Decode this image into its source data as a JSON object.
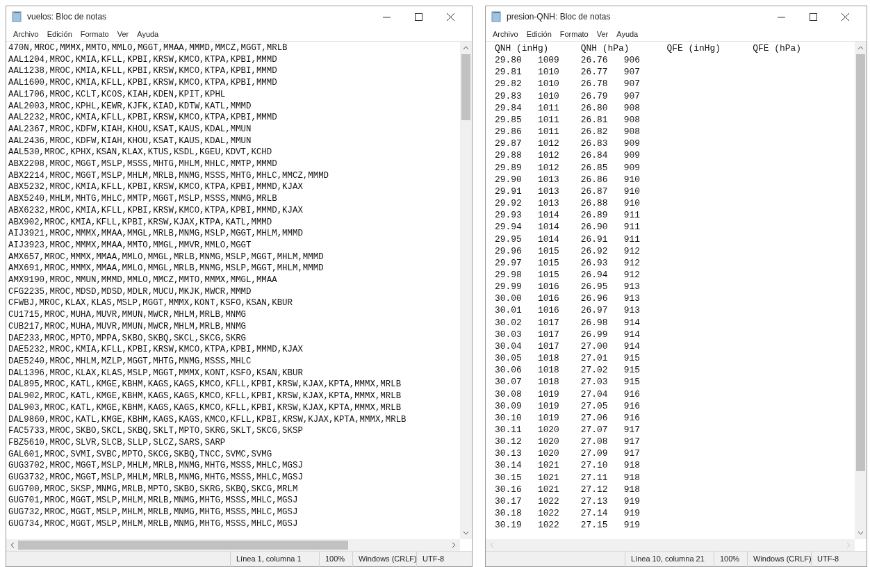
{
  "windows": [
    {
      "title": "vuelos: Bloc de notas",
      "menu": [
        "Archivo",
        "Edición",
        "Formato",
        "Ver",
        "Ayuda"
      ],
      "lines": [
        "470N,MROC,MMMX,MMTO,MMLO,MGGT,MMAA,MMMD,MMCZ,MGGT,MRLB",
        "AAL1204,MROC,KMIA,KFLL,KPBI,KRSW,KMCO,KTPA,KPBI,MMMD",
        "AAL1238,MROC,KMIA,KFLL,KPBI,KRSW,KMCO,KTPA,KPBI,MMMD",
        "AAL1600,MROC,KMIA,KFLL,KPBI,KRSW,KMCO,KTPA,KPBI,MMMD",
        "AAL1706,MROC,KCLT,KCOS,KIAH,KDEN,KPIT,KPHL",
        "AAL2003,MROC,KPHL,KEWR,KJFK,KIAD,KDTW,KATL,MMMD",
        "AAL2232,MROC,KMIA,KFLL,KPBI,KRSW,KMCO,KTPA,KPBI,MMMD",
        "AAL2367,MROC,KDFW,KIAH,KHOU,KSAT,KAUS,KDAL,MMUN",
        "AAL2436,MROC,KDFW,KIAH,KHOU,KSAT,KAUS,KDAL,MMUN",
        "AAL530,MROC,KPHX,KSAN,KLAX,KTUS,KSDL,KGEU,KDVT,KCHD",
        "ABX2208,MROC,MGGT,MSLP,MSSS,MHTG,MHLM,MHLC,MMTP,MMMD",
        "ABX2214,MROC,MGGT,MSLP,MHLM,MRLB,MNMG,MSSS,MHTG,MHLC,MMCZ,MMMD",
        "ABX5232,MROC,KMIA,KFLL,KPBI,KRSW,KMCO,KTPA,KPBI,MMMD,KJAX",
        "ABX5240,MHLM,MHTG,MHLC,MMTP,MGGT,MSLP,MSSS,MNMG,MRLB",
        "ABX6232,MROC,KMIA,KFLL,KPBI,KRSW,KMCO,KTPA,KPBI,MMMD,KJAX",
        "ABX902,MROC,KMIA,KFLL,KPBI,KRSW,KJAX,KTPA,KATL,MMMD",
        "AIJ3921,MROC,MMMX,MMAA,MMGL,MRLB,MNMG,MSLP,MGGT,MHLM,MMMD",
        "AIJ3923,MROC,MMMX,MMAA,MMTO,MMGL,MMVR,MMLO,MGGT",
        "AMX657,MROC,MMMX,MMAA,MMLO,MMGL,MRLB,MNMG,MSLP,MGGT,MHLM,MMMD",
        "AMX691,MROC,MMMX,MMAA,MMLO,MMGL,MRLB,MNMG,MSLP,MGGT,MHLM,MMMD",
        "AMX9190,MROC,MMUN,MMMD,MMLO,MMCZ,MMTO,MMMX,MMGL,MMAA",
        "CFG2235,MROC,MDSD,MDSD,MDLR,MUCU,MKJK,MWCR,MMMD",
        "CFWBJ,MROC,KLAX,KLAS,MSLP,MGGT,MMMX,KONT,KSFO,KSAN,KBUR",
        "CU1715,MROC,MUHA,MUVR,MMUN,MWCR,MHLM,MRLB,MNMG",
        "CUB217,MROC,MUHA,MUVR,MMUN,MWCR,MHLM,MRLB,MNMG",
        "DAE233,MROC,MPTO,MPPA,SKBO,SKBQ,SKCL,SKCG,SKRG",
        "DAE5232,MROC,KMIA,KFLL,KPBI,KRSW,KMCO,KTPA,KPBI,MMMD,KJAX",
        "DAE5240,MROC,MHLM,MZLP,MGGT,MHTG,MNMG,MSSS,MHLC",
        "DAL1396,MROC,KLAX,KLAS,MSLP,MGGT,MMMX,KONT,KSFO,KSAN,KBUR",
        "DAL895,MROC,KATL,KMGE,KBHM,KAGS,KAGS,KMCO,KFLL,KPBI,KRSW,KJAX,KPTA,MMMX,MRLB",
        "DAL902,MROC,KATL,KMGE,KBHM,KAGS,KAGS,KMCO,KFLL,KPBI,KRSW,KJAX,KPTA,MMMX,MRLB",
        "DAL903,MROC,KATL,KMGE,KBHM,KAGS,KAGS,KMCO,KFLL,KPBI,KRSW,KJAX,KPTA,MMMX,MRLB",
        "DAL9860,MROC,KATL,KMGE,KBHM,KAGS,KAGS,KMCO,KFLL,KPBI,KRSW,KJAX,KPTA,MMMX,MRLB",
        "FAC5733,MROC,SKBO,SKCL,SKBQ,SKLT,MPTO,SKRG,SKLT,SKCG,SKSP",
        "FBZ5610,MROC,SLVR,SLCB,SLLP,SLCZ,SARS,SARP",
        "GAL601,MROC,SVMI,SVBC,MPTO,SKCG,SKBQ,TNCC,SVMC,SVMG",
        "GUG3702,MROC,MGGT,MSLP,MHLM,MRLB,MNMG,MHTG,MSSS,MHLC,MGSJ",
        "GUG3732,MROC,MGGT,MSLP,MHLM,MRLB,MNMG,MHTG,MSSS,MHLC,MGSJ",
        "GUG700,MROC,SKSP,MNMG,MRLB,MPTO,SKBO,SKRG,SKBQ,SKCG,MRLM",
        "GUG701,MROC,MGGT,MSLP,MHLM,MRLB,MNMG,MHTG,MSSS,MHLC,MGSJ",
        "GUG732,MROC,MGGT,MSLP,MHLM,MRLB,MNMG,MHTG,MSSS,MHLC,MGSJ",
        "GUG734,MROC,MGGT,MSLP,MHLM,MRLB,MNMG,MHTG,MSSS,MHLC,MGSJ"
      ],
      "status": [
        "Línea 1, columna 1",
        "100%",
        "Windows (CRLF)",
        "UTF-8"
      ]
    },
    {
      "title": "presion-QNH: Bloc de notas",
      "menu": [
        "Archivo",
        "Edición",
        "Formato",
        "Ver",
        "Ayuda"
      ],
      "lines": [
        "QNH (inHg)\tQNH (hPa)\tQFE (inHg)\tQFE (hPa)",
        "29.80\t1009\t26.76\t906",
        "29.81\t1010\t26.77\t907",
        "29.82\t1010\t26.78\t907",
        "29.83\t1010\t26.79\t907",
        "29.84\t1011\t26.80\t908",
        "29.85\t1011\t26.81\t908",
        "29.86\t1011\t26.82\t908",
        "29.87\t1012\t26.83\t909",
        "29.88\t1012\t26.84\t909",
        "29.89\t1012\t26.85\t909",
        "29.90\t1013\t26.86\t910",
        "29.91\t1013\t26.87\t910",
        "29.92\t1013\t26.88\t910",
        "29.93\t1014\t26.89\t911",
        "29.94\t1014\t26.90\t911",
        "29.95\t1014\t26.91\t911",
        "29.96\t1015\t26.92\t912",
        "29.97\t1015\t26.93\t912",
        "29.98\t1015\t26.94\t912",
        "29.99\t1016\t26.95\t913",
        "30.00\t1016\t26.96\t913",
        "30.01\t1016\t26.97\t913",
        "30.02\t1017\t26.98\t914",
        "30.03\t1017\t26.99\t914",
        "30.04\t1017\t27.00\t914",
        "30.05\t1018\t27.01\t915",
        "30.06\t1018\t27.02\t915",
        "30.07\t1018\t27.03\t915",
        "30.08\t1019\t27.04\t916",
        "30.09\t1019\t27.05\t916",
        "30.10\t1019\t27.06\t916",
        "30.11\t1020\t27.07\t917",
        "30.12\t1020\t27.08\t917",
        "30.13\t1020\t27.09\t917",
        "30.14\t1021\t27.10\t918",
        "30.15\t1021\t27.11\t918",
        "30.16\t1021\t27.12\t918",
        "30.17\t1022\t27.13\t919",
        "30.18\t1022\t27.14\t919",
        "30.19\t1022\t27.15\t919"
      ],
      "status": [
        "Línea 10, columna 21",
        "100%",
        "Windows (CRLF)",
        "UTF-8"
      ]
    }
  ]
}
